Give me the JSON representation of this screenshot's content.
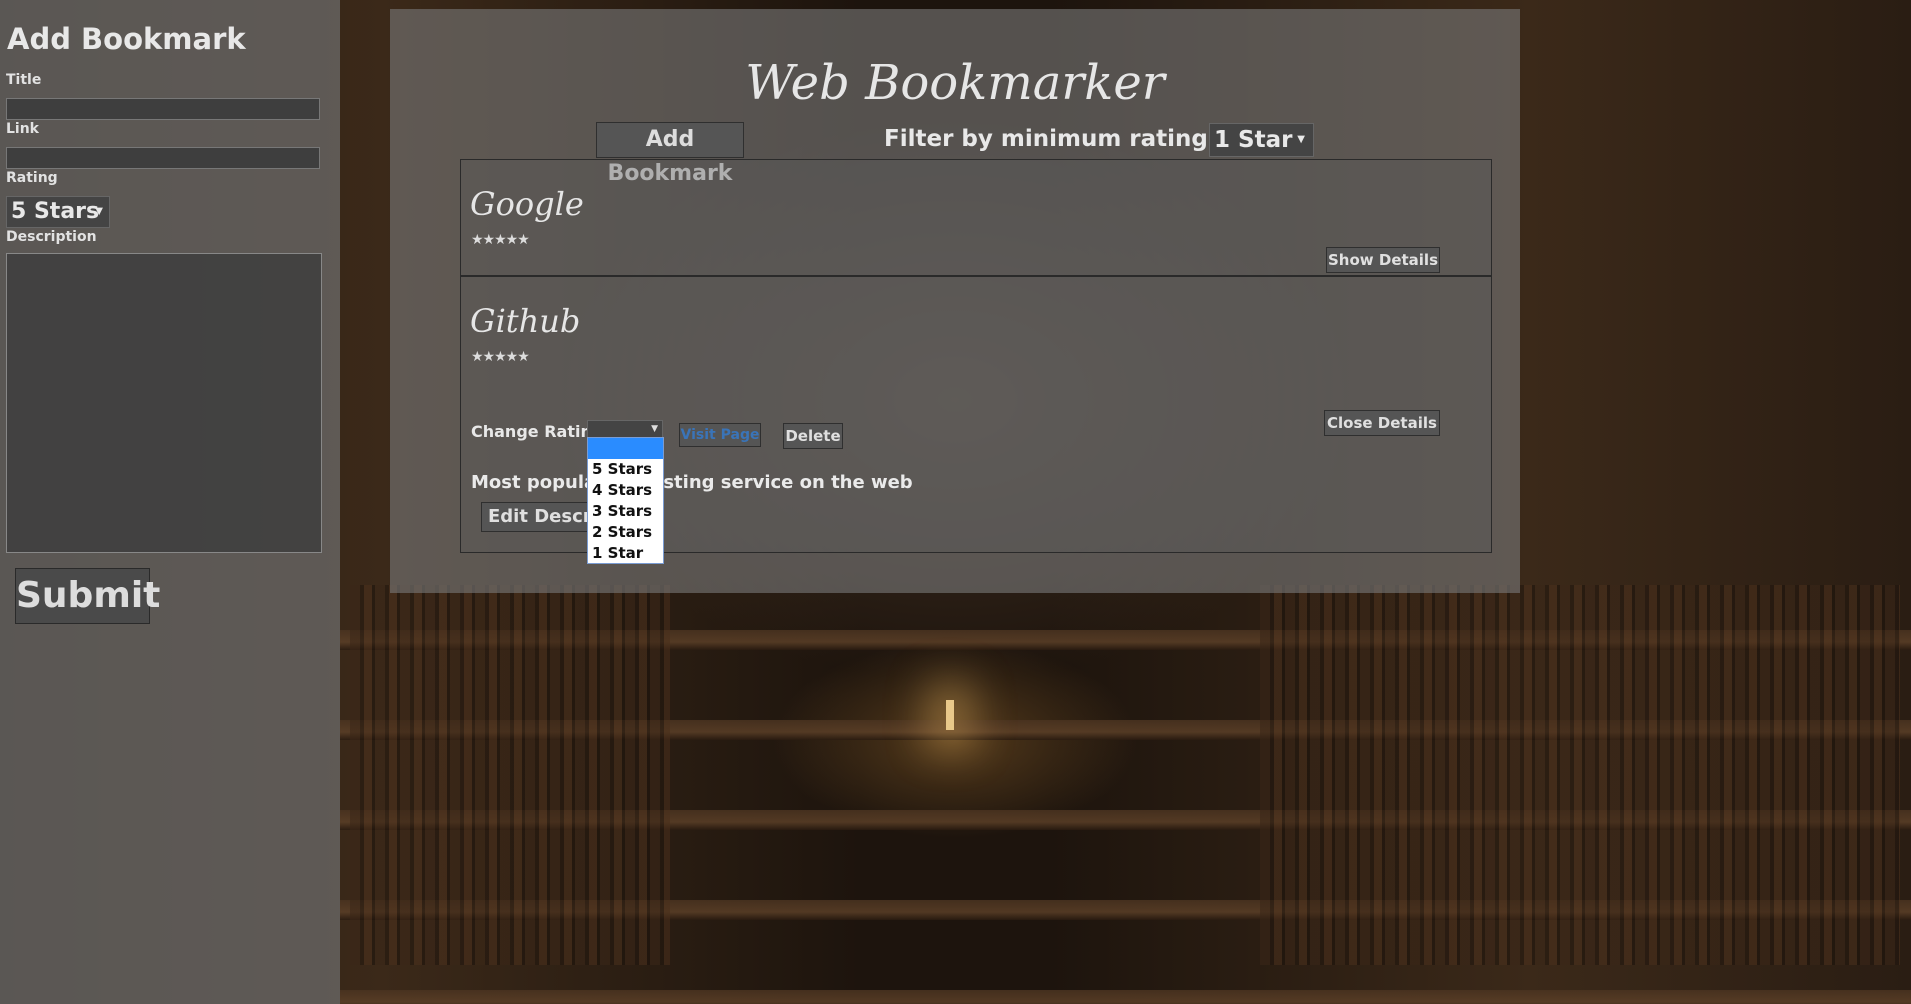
{
  "sidebar": {
    "heading": "Add Bookmark",
    "title_label": "Title",
    "link_label": "Link",
    "rating_label": "Rating",
    "rating_value": "5 Stars",
    "description_label": "Description",
    "submit_label": "Submit"
  },
  "main": {
    "title": "Web Bookmarker",
    "add_bookmark_label": "Add Bookmark",
    "filter_label": "Filter by minimum rating of:",
    "filter_value": "1 Star"
  },
  "bookmarks": [
    {
      "title": "Google",
      "stars": "★★★★★",
      "rating": 5,
      "details_button": "Show Details"
    },
    {
      "title": "Github",
      "stars": "★★★★★",
      "rating": 5,
      "change_rating_label": "Change Rating",
      "visit_label": "Visit Page",
      "delete_label": "Delete",
      "details_button": "Close Details",
      "description": "Most popular ry hosting service on the web",
      "edit_label": "Edit Description"
    }
  ],
  "rating_dropdown": {
    "options": [
      "",
      "5 Stars",
      "4 Stars",
      "3 Stars",
      "2 Stars",
      "1 Star"
    ],
    "selected_index": 0
  }
}
